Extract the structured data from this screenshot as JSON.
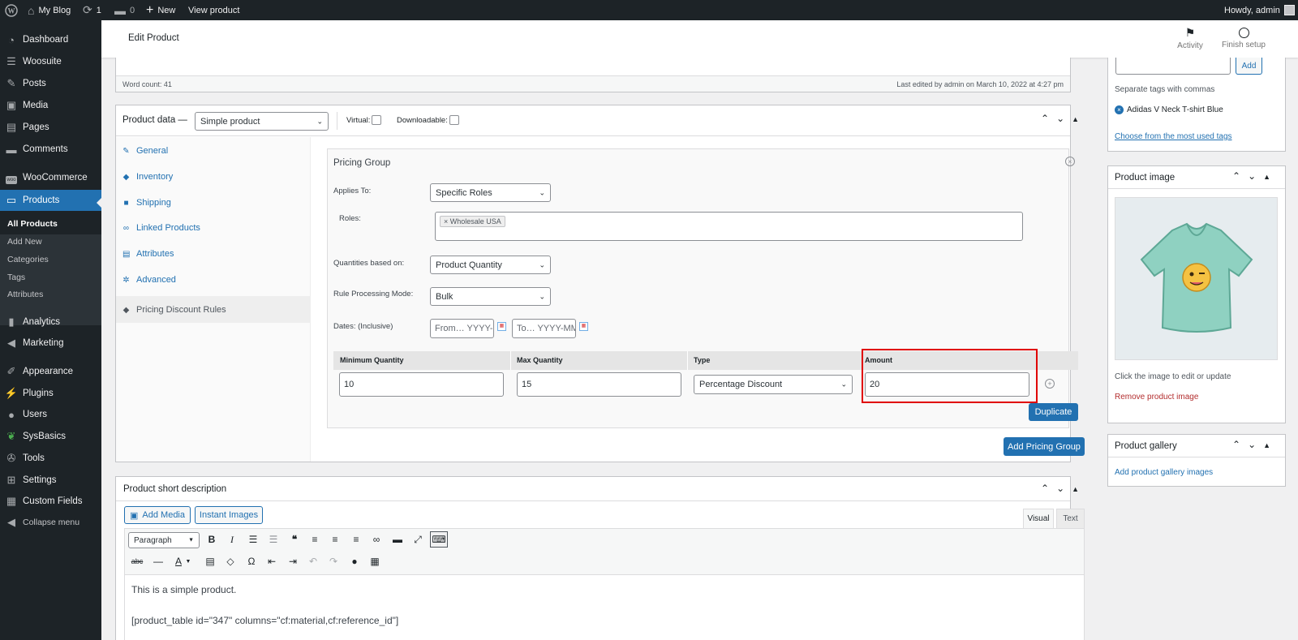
{
  "adminbar": {
    "site_name": "My Blog",
    "updates_count": "1",
    "comments_count": "0",
    "new_label": "New",
    "view_product": "View product",
    "howdy": "Howdy, admin"
  },
  "sidebar": {
    "items": [
      {
        "label": "Dashboard",
        "icon": "dashboard-icon"
      },
      {
        "label": "Woosuite",
        "icon": "woosuite-icon"
      },
      {
        "label": "Posts",
        "icon": "pin-icon"
      },
      {
        "label": "Media",
        "icon": "media-icon"
      },
      {
        "label": "Pages",
        "icon": "page-icon"
      },
      {
        "label": "Comments",
        "icon": "comment-icon"
      },
      {
        "label": "WooCommerce",
        "icon": "woo-icon"
      },
      {
        "label": "Products",
        "icon": "products-icon"
      },
      {
        "label": "Analytics",
        "icon": "chart-icon"
      },
      {
        "label": "Marketing",
        "icon": "megaphone-icon"
      },
      {
        "label": "Appearance",
        "icon": "brush-icon"
      },
      {
        "label": "Plugins",
        "icon": "plug-icon"
      },
      {
        "label": "Users",
        "icon": "user-icon"
      },
      {
        "label": "SysBasics",
        "icon": "leaf-icon"
      },
      {
        "label": "Tools",
        "icon": "wrench-icon"
      },
      {
        "label": "Settings",
        "icon": "settings-icon"
      },
      {
        "label": "Custom Fields",
        "icon": "fields-icon"
      },
      {
        "label": "Collapse menu",
        "icon": "collapse-icon"
      }
    ],
    "submenu": [
      "All Products",
      "Add New",
      "Categories",
      "Tags",
      "Attributes"
    ]
  },
  "header": {
    "title": "Edit Product",
    "activity": "Activity",
    "finish_setup": "Finish setup"
  },
  "editor_status": {
    "word_count": "Word count: 41",
    "last_edited": "Last edited by admin on March 10, 2022 at 4:27 pm"
  },
  "product_data": {
    "label": "Product data —",
    "type_value": "Simple product",
    "virtual_label": "Virtual:",
    "downloadable_label": "Downloadable:",
    "tabs": [
      {
        "label": "General",
        "icon": "wrench-icon"
      },
      {
        "label": "Inventory",
        "icon": "tag-icon"
      },
      {
        "label": "Shipping",
        "icon": "truck-icon"
      },
      {
        "label": "Linked Products",
        "icon": "link-icon"
      },
      {
        "label": "Attributes",
        "icon": "table-icon"
      },
      {
        "label": "Advanced",
        "icon": "gear-icon"
      },
      {
        "label": "Pricing Discount Rules",
        "icon": "tag-icon"
      }
    ]
  },
  "pricing_group": {
    "title": "Pricing Group",
    "applies_to_label": "Applies To:",
    "applies_to_value": "Specific Roles",
    "roles_label": "Roles:",
    "role_token": "× Wholesale USA",
    "qty_based_label": "Quantities based on:",
    "qty_based_value": "Product Quantity",
    "mode_label": "Rule Processing Mode:",
    "mode_value": "Bulk",
    "dates_label": "Dates: (Inclusive)",
    "from_placeholder": "From… YYYY-MM-DD",
    "to_placeholder": "To… YYYY-MM-DD",
    "columns": [
      "Minimum Quantity",
      "Max Quantity",
      "Type",
      "Amount"
    ],
    "row": {
      "min": "10",
      "max": "15",
      "type": "Percentage Discount",
      "amount": "20"
    },
    "duplicate_label": "Duplicate",
    "add_group_label": "Add Pricing Group"
  },
  "short_desc": {
    "title": "Product short description",
    "add_media": "Add Media",
    "instant_images": "Instant Images",
    "tab_visual": "Visual",
    "tab_text": "Text",
    "format_value": "Paragraph",
    "line1": "This is a simple product.",
    "line2": "[product_table id=\"347\" columns=\"cf:material,cf:reference_id\"]"
  },
  "tags_box": {
    "add_label": "Add",
    "hint": "Separate tags with commas",
    "tag": "Adidas V Neck T-shirt Blue",
    "choose_link": "Choose from the most used tags"
  },
  "product_image": {
    "title": "Product image",
    "hint": "Click the image to edit or update",
    "remove": "Remove product image"
  },
  "product_gallery": {
    "title": "Product gallery",
    "add_link": "Add product gallery images"
  },
  "colors": {
    "accent": "#2271b1",
    "highlight": "#e00000",
    "danger": "#b32d2e"
  }
}
